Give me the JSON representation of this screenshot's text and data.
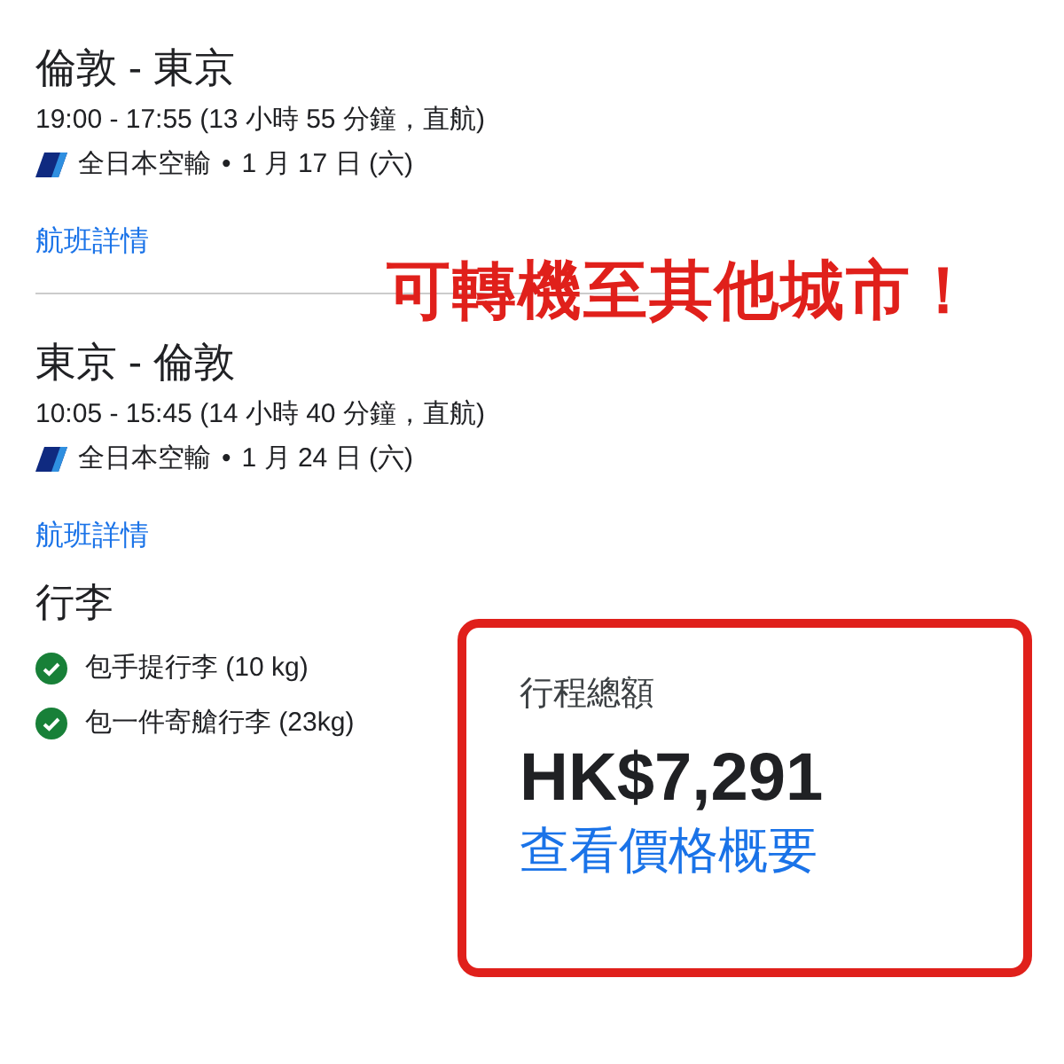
{
  "flights": [
    {
      "route": "倫敦 - 東京",
      "times": "19:00 - 17:55 (13 小時 55 分鐘，直航)",
      "airline": "全日本空輸",
      "separator": "•",
      "date": "1 月 17 日 (六)",
      "details_link": "航班詳情"
    },
    {
      "route": "東京 - 倫敦",
      "times": "10:05 - 15:45 (14 小時 40 分鐘，直航)",
      "airline": "全日本空輸",
      "separator": "•",
      "date": "1 月 24 日 (六)",
      "details_link": "航班詳情"
    }
  ],
  "annotation": "可轉機至其他城市！",
  "baggage": {
    "title": "行李",
    "items": [
      {
        "label": "包手提行李 (10 kg)",
        "included": true
      },
      {
        "label": "包一件寄艙行李 (23kg)",
        "included": true
      }
    ]
  },
  "price": {
    "label": "行程總額",
    "amount": "HK$7,291",
    "link": "查看價格概要"
  }
}
